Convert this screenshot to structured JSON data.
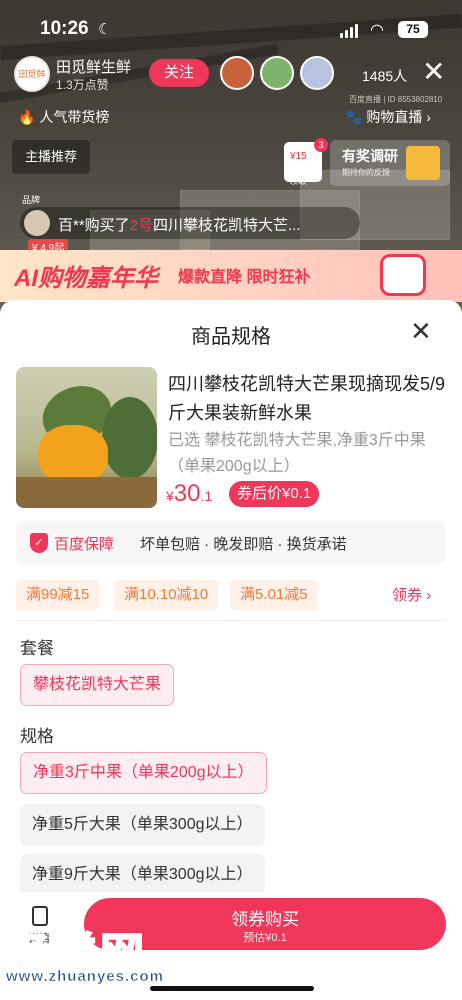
{
  "status": {
    "time": "10:26",
    "battery": "75"
  },
  "live": {
    "host_name": "田觅鲜生鲜",
    "host_likes": "1.3万点赞",
    "host_logo_text": "田觅鲜",
    "follow_label": "关注",
    "viewer_count": "1485人",
    "room_id": "百度直播 | ID 8553802810",
    "tag_left": "人气带货榜",
    "tag_right": "购物直播",
    "anchor_recommend": "主播推荐",
    "coupon_amount": "¥15",
    "coupon_badge": "3",
    "coupon_label": "领取",
    "survey_title": "有奖调研",
    "survey_sub": "期待你的反馈",
    "brand_tag": "品牌",
    "ticker_prefix": "百**购买了",
    "ticker_num": "2号",
    "ticker_product": "四川攀枝花凯特大芒...",
    "ticker_price": "¥ 4.9起",
    "promo_title": "AI购物嘉年华",
    "promo_sub": "爆款直降  限时狂补"
  },
  "sheet": {
    "title": "商品规格",
    "product_name": "四川攀枝花凯特大芒果现摘现发5/9斤大果装新鲜水果",
    "selected": "已选 攀枝花凯特大芒果,净重3斤中果（单果200g以上）",
    "price_symbol": "¥",
    "price_int": "30",
    "price_dec": ".1",
    "after_coupon": "券后价¥0.1",
    "guarantee_name": "百度保障",
    "guarantee_items": "坏单包赔 · 晚发即赔 · 换货承诺",
    "coupons": [
      "满99减15",
      "满10.10减10",
      "满5.01减5"
    ],
    "claim_label": "领券 ›",
    "package_label": "套餐",
    "package_options": [
      "攀枝花凯特大芒果"
    ],
    "spec_label": "规格",
    "spec_options": [
      "净重3斤中果（单果200g以上）",
      "净重5斤大果（单果300g以上）",
      "净重9斤大果（单果300g以上）"
    ]
  },
  "bottom": {
    "detail_label": "详情",
    "buy_label": "领券购买",
    "buy_sub": "预估¥0.1"
  },
  "watermark": {
    "text": "好赚网",
    "url": "www.zhuanyes.com"
  }
}
